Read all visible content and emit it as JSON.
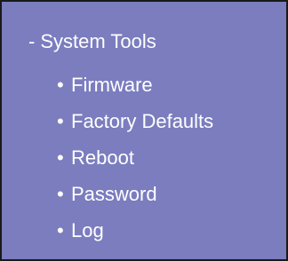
{
  "nav": {
    "section": {
      "toggle": "-",
      "title": "System Tools"
    },
    "bullet": "•",
    "items": [
      {
        "label": "Firmware"
      },
      {
        "label": "Factory Defaults"
      },
      {
        "label": "Reboot"
      },
      {
        "label": "Password"
      },
      {
        "label": "Log"
      }
    ]
  },
  "colors": {
    "panel_background": "#7b7dbf",
    "panel_border": "#1a1a1a",
    "text": "#ffffff"
  }
}
